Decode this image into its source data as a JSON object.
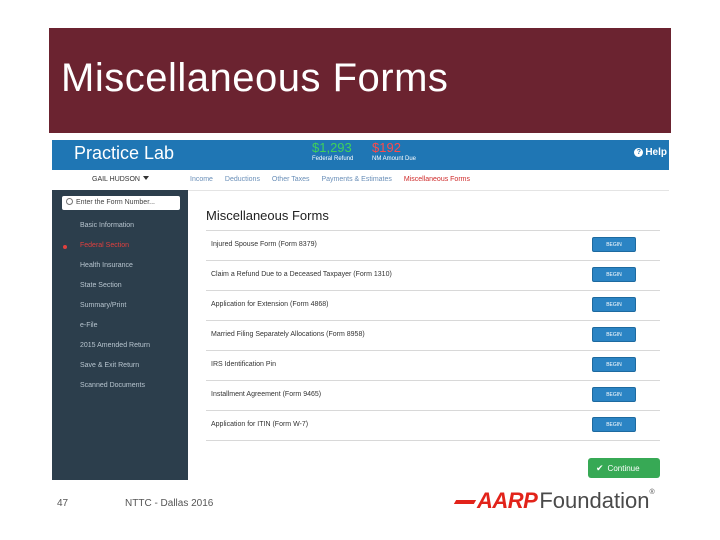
{
  "slide": {
    "title": "Miscellaneous Forms",
    "page_number": "47",
    "footer_text": "NTTC - Dallas 2016",
    "logo": {
      "brand": "AARP",
      "word": "Foundation",
      "mark": "®"
    }
  },
  "app": {
    "brand": "Practice Lab",
    "federal_refund": {
      "amount": "$1,293",
      "label": "Federal Refund"
    },
    "state_refund": {
      "amount": "$192",
      "label": "NM Amount Due"
    },
    "help_label": "Help",
    "user_name": "GAIL HUDSON",
    "tabs": [
      {
        "label": "Income"
      },
      {
        "label": "Deductions"
      },
      {
        "label": "Other Taxes"
      },
      {
        "label": "Payments & Estimates"
      },
      {
        "label": "Miscellaneous Forms"
      }
    ],
    "search_placeholder": "Enter the Form Number...",
    "sidebar": [
      {
        "label": "Basic Information"
      },
      {
        "label": "Federal Section"
      },
      {
        "label": "Health Insurance"
      },
      {
        "label": "State Section"
      },
      {
        "label": "Summary/Print"
      },
      {
        "label": "e-File"
      },
      {
        "label": "2015 Amended Return"
      },
      {
        "label": "Save & Exit Return"
      },
      {
        "label": "Scanned Documents"
      }
    ],
    "section_title": "Miscellaneous Forms",
    "forms": [
      {
        "name": "Injured Spouse Form (Form 8379)",
        "button": "BEGIN"
      },
      {
        "name": "Claim a Refund Due to a Deceased Taxpayer (Form 1310)",
        "button": "BEGIN"
      },
      {
        "name": "Application for Extension (Form 4868)",
        "button": "BEGIN"
      },
      {
        "name": "Married Filing Separately Allocations (Form 8958)",
        "button": "BEGIN"
      },
      {
        "name": "IRS Identification Pin",
        "button": "BEGIN"
      },
      {
        "name": "Installment Agreement (Form 9465)",
        "button": "BEGIN"
      },
      {
        "name": "Application for ITIN (Form W-7)",
        "button": "BEGIN"
      }
    ],
    "continue_label": "Continue",
    "colors": {
      "header": "#1f76b4",
      "sidebar": "#2c3e4c",
      "title_bar": "#6b2330",
      "accent_red": "#e0403e",
      "continue": "#37a955"
    }
  }
}
